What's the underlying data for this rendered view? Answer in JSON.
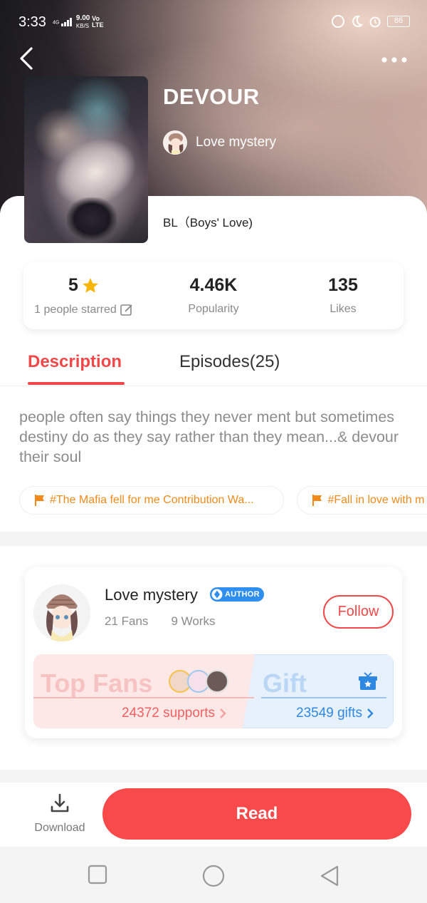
{
  "status_bar": {
    "time": "3:33",
    "network": "4G",
    "speed_value": "9.00",
    "speed_unit": "KB/S",
    "carrier": "Vo LTE",
    "battery": "86"
  },
  "header": {
    "back_icon": "chevron-left-icon",
    "more_icon": "more-horizontal-icon"
  },
  "book": {
    "title": "DEVOUR",
    "author": "Love mystery",
    "genre": "BL（Boys' Love)"
  },
  "stats": {
    "rating": "5",
    "rating_label": "1 people starred",
    "popularity": "4.46K",
    "popularity_label": "Popularity",
    "likes": "135",
    "likes_label": "Likes"
  },
  "tabs": {
    "description": "Description",
    "episodes": "Episodes(25)"
  },
  "description": "people often say things they never ment but sometimes destiny do as they say rather than they mean...& devour their soul",
  "tags": [
    {
      "label": "#The Mafia fell for me Contribution Wa..."
    },
    {
      "label": "#Fall in love with m"
    }
  ],
  "author_card": {
    "name": "Love mystery",
    "badge": "AUTHOR",
    "fans": "21 Fans",
    "works": "9 Works",
    "follow": "Follow",
    "top_fans_title": "Top Fans",
    "supports": "24372 supports",
    "gift_title": "Gift",
    "gifts": "23549 gifts"
  },
  "action_bar": {
    "download": "Download",
    "read": "Read"
  },
  "colors": {
    "accent": "#f04848",
    "read_button": "#f84a4a",
    "tag_text": "#f08a1a",
    "author_badge": "#2f8ff0",
    "star": "#f7b500"
  }
}
